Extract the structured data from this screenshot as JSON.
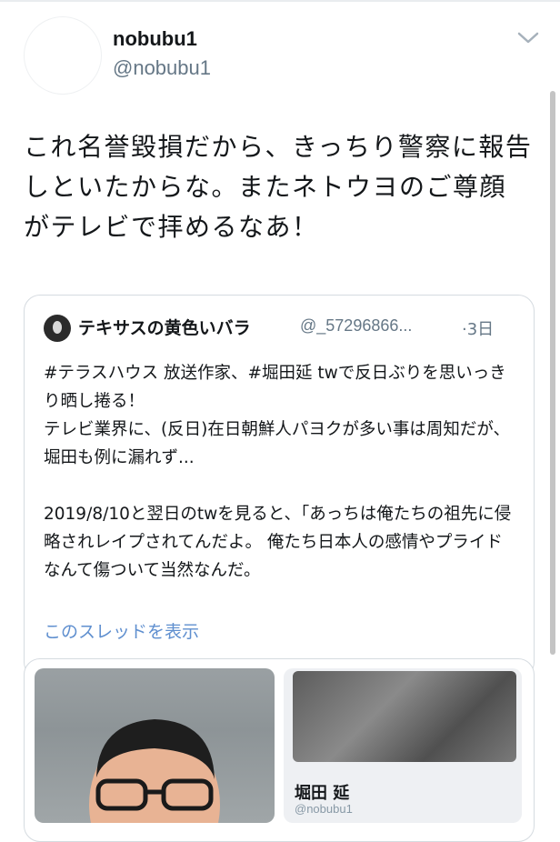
{
  "tweet": {
    "display_name": "nobubu1",
    "handle": "@nobubu1",
    "text": "これ名誉毀損だから、きっちり警察に報告しといたからな。またネトウヨのご尊顔がテレビで拝めるなあ！"
  },
  "quoted_tweet": {
    "display_name": "テキサスの黄色いバラ",
    "handle": "@_57296866...",
    "time": "·3日",
    "text": "#テラスハウス 放送作家、#堀田延 twで反日ぶりを思いっきり晒し捲る！\nテレビ業界に、(反日)在日朝鮮人パヨクが多い事は周知だが、堀田も例に漏れず...\n\n2019/8/10と翌日のtwを見ると、「あっちは俺たちの祖先に侵略されレイプされてんだよ。 俺たち日本人の感情やプライドなんて傷ついて当然なんだ。",
    "show_thread_link": "このスレッドを表示"
  },
  "embedded_media": {
    "profile_name": "堀田 延",
    "profile_handle": "@nobubu1"
  },
  "icons": {
    "menu": "chevron-down-icon",
    "avatar": "avatar-icon"
  },
  "colors": {
    "link": "#5f8fcf",
    "secondary_text": "#657786",
    "border": "#d5dbe0"
  }
}
